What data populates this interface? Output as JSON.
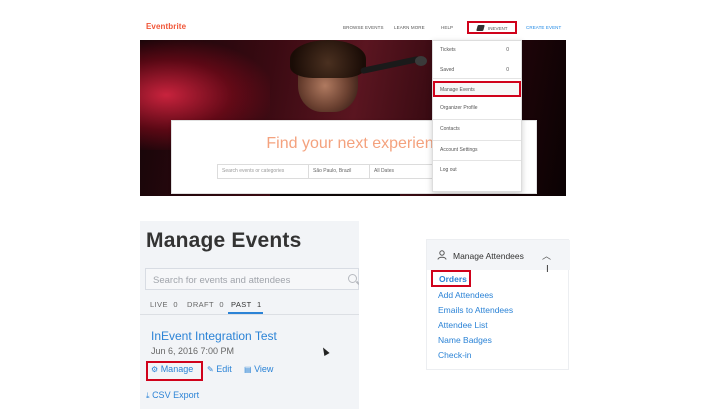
{
  "eventbrite": {
    "logo": "Eventbrite",
    "nav": {
      "browse": "BROWSE EVENTS",
      "learn": "LEARN MORE",
      "help": "HELP",
      "account": "INEVENT",
      "create": "CREATE EVENT"
    },
    "hero_heading": "Find your next experienc",
    "search": {
      "placeholder": "Search events or categories",
      "location": "São Paulo, Brazil",
      "date": "All Dates"
    },
    "dropdown": {
      "tickets": "Tickets",
      "tickets_count": "0",
      "saved": "Saved",
      "saved_count": "0",
      "manage_events": "Manage Events",
      "organizer_profile": "Organizer Profile",
      "contacts": "Contacts",
      "account_settings": "Account Settings",
      "logout": "Log out"
    }
  },
  "manage_events": {
    "title": "Manage Events",
    "search_placeholder": "Search for events and attendees",
    "tabs": [
      {
        "label": "LIVE",
        "count": "0"
      },
      {
        "label": "DRAFT",
        "count": "0"
      },
      {
        "label": "PAST",
        "count": "1"
      }
    ],
    "event": {
      "title": "InEvent Integration Test",
      "date": "Jun 6, 2016 7:00 PM",
      "manage": "Manage",
      "edit": "Edit",
      "view": "View"
    },
    "csv_export": "CSV Export"
  },
  "manage_attendees": {
    "title": "Manage Attendees",
    "links": [
      "Orders",
      "Add Attendees",
      "Emails to Attendees",
      "Attendee List",
      "Name Badges",
      "Check-in"
    ]
  },
  "colors": {
    "brand_orange": "#f05537",
    "link_blue": "#2b83d6",
    "highlight_red": "#d0021b"
  }
}
